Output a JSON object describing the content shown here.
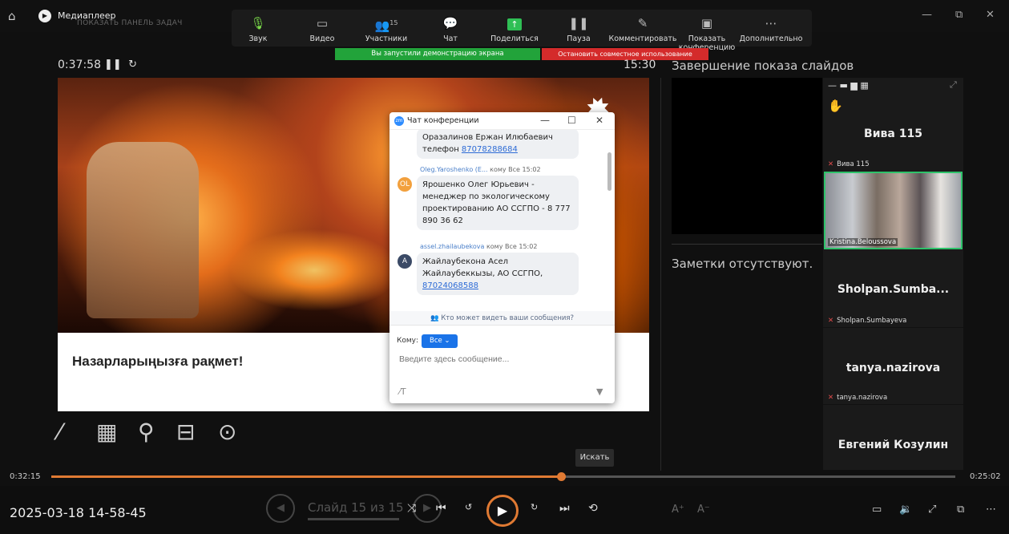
{
  "titlebar": {
    "app_title": "Медиаплеер",
    "ghost_text": "ПОКАЗАТЬ ПАНЕЛЬ ЗАДАЧ",
    "ghost_short": "П"
  },
  "zoom_toolbar": {
    "items": [
      {
        "label": "Звук",
        "icon": "mic-icon"
      },
      {
        "label": "Видео",
        "icon": "camera-icon"
      },
      {
        "label": "Участники",
        "icon": "participants-icon",
        "count": "15"
      },
      {
        "label": "Чат",
        "icon": "chat-icon"
      },
      {
        "label": "Поделиться",
        "icon": "share-icon"
      },
      {
        "label": "Пауза",
        "icon": "pause-icon"
      },
      {
        "label": "Комментировать",
        "icon": "annotate-icon"
      },
      {
        "label": "Показать конференцию",
        "icon": "show-meeting-icon"
      },
      {
        "label": "Дополнительно",
        "icon": "more-icon"
      }
    ],
    "share_banner": "Вы запустили демонстрацию экрана",
    "stop_banner": "Остановить совместное использование"
  },
  "presenter": {
    "elapsed": "0:37:58",
    "clock": "15:30",
    "end_show": "Завершение показа слайдов",
    "slide_text": "Назарларыңызға рақмет!",
    "notes": "Заметки отсутствуют."
  },
  "chat": {
    "title": "Чат конференции",
    "messages": [
      {
        "sender": "",
        "to": "",
        "time": "",
        "avatar": "",
        "avatar_color": "#888",
        "line1": "Оразалинов Ержан Илюбаевич",
        "line2": "телефон ",
        "link": "87078288684"
      },
      {
        "sender": "Oleg.Yaroshenko (E...",
        "to": "кому Все",
        "time": "15:02",
        "avatar": "OL",
        "avatar_color": "#f2a03d",
        "text": "Ярошенко Олег Юрьевич - менеджер по экологическому проектированию АО ССГПО - 8 777 890 36 62"
      },
      {
        "sender": "assel.zhailaubekova",
        "to": "кому Все",
        "time": "15:02",
        "avatar": "A",
        "avatar_color": "#3b4a66",
        "line1": "Жайлаубекона Асел Жайлаубеккызы, АО ССГПО,",
        "link": "87024068588"
      }
    ],
    "privacy": "Кто может видеть ваши сообщения?",
    "to_label": "Кому:",
    "to_value": "Все",
    "input_placeholder": "Введите здесь сообщение..."
  },
  "gallery": {
    "tiles": [
      {
        "name": "Вива 115",
        "sub": "Вива 115",
        "hand": true
      },
      {
        "name": "Kristina.Beloussova",
        "video": true
      },
      {
        "name": "Sholpan.Sumba...",
        "sub": "Sholpan.Sumbayeva"
      },
      {
        "name": "tanya.nazirova",
        "sub": "tanya.nazirova"
      },
      {
        "name": "Евгений Козулин",
        "sub": ""
      }
    ]
  },
  "player": {
    "current_time": "0:32:15",
    "total_time": "0:25:02",
    "progress": 0.564,
    "tooltip": "Искать",
    "filename": "2025-03-18 14-58-45",
    "slide_nav": "Слайд 15 из 15"
  },
  "colors": {
    "accent": "#e07a33",
    "share_green": "#22a33a",
    "stop_red": "#d42b2b",
    "active_speaker": "#2ec26a"
  }
}
